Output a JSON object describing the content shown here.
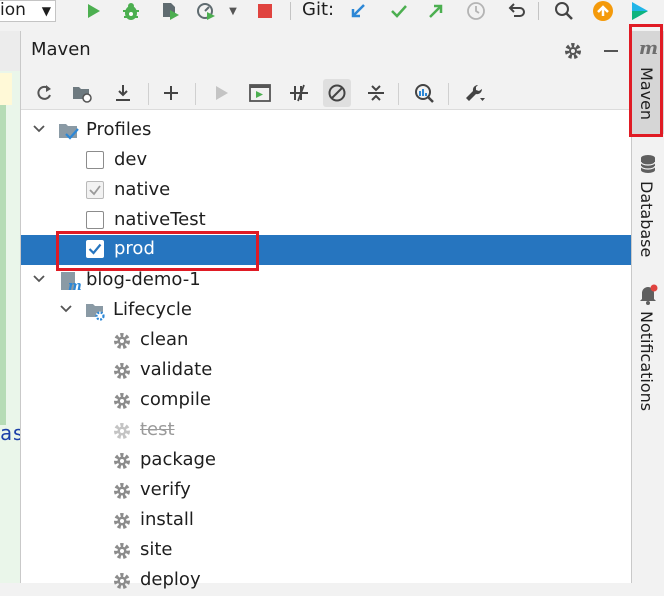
{
  "top_toolbar": {
    "run_config_label": "ion",
    "git_label": "Git:",
    "icons": [
      "chevron-down-icon",
      "run-icon",
      "debug-icon",
      "coverage-icon",
      "profile-icon",
      "stop-icon",
      "git-update-icon",
      "git-commit-icon",
      "git-push-icon",
      "history-icon",
      "rollback-icon",
      "search-icon",
      "update-icon",
      "toolbox-icon"
    ]
  },
  "editor_strip": {
    "snippet": "as"
  },
  "maven_panel": {
    "title": "Maven",
    "toolbar_icons": [
      "reload-icon",
      "generate-sources-icon",
      "download-icon",
      "add-icon",
      "run-icon",
      "execute-goal-icon",
      "toggle-offline-icon",
      "skip-tests-icon",
      "collapse-all-icon",
      "analyze-dependencies-icon",
      "settings-wrench-icon"
    ],
    "tree": {
      "profiles_label": "Profiles",
      "profiles": [
        {
          "name": "dev",
          "checked": false,
          "state": "unchecked"
        },
        {
          "name": "native",
          "checked": true,
          "state": "checked-disabled"
        },
        {
          "name": "nativeTest",
          "checked": false,
          "state": "unchecked"
        },
        {
          "name": "prod",
          "checked": true,
          "state": "checked-selected"
        }
      ],
      "project_label": "blog-demo-1",
      "lifecycle_label": "Lifecycle",
      "lifecycle_goals": [
        {
          "name": "clean",
          "skipped": false
        },
        {
          "name": "validate",
          "skipped": false
        },
        {
          "name": "compile",
          "skipped": false
        },
        {
          "name": "test",
          "skipped": true
        },
        {
          "name": "package",
          "skipped": false
        },
        {
          "name": "verify",
          "skipped": false
        },
        {
          "name": "install",
          "skipped": false
        },
        {
          "name": "site",
          "skipped": false
        },
        {
          "name": "deploy",
          "skipped": false
        }
      ]
    }
  },
  "right_strip": {
    "tools": [
      {
        "label": "Maven",
        "icon": "maven-icon",
        "active": true
      },
      {
        "label": "Database",
        "icon": "database-icon",
        "active": false
      },
      {
        "label": "Notifications",
        "icon": "bell-icon",
        "active": false
      }
    ]
  },
  "colors": {
    "selection": "#2675bf",
    "highlight": "#e01b24",
    "run_green": "#4caf50",
    "stop_red": "#e0433f",
    "git_blue": "#2c87d6"
  }
}
